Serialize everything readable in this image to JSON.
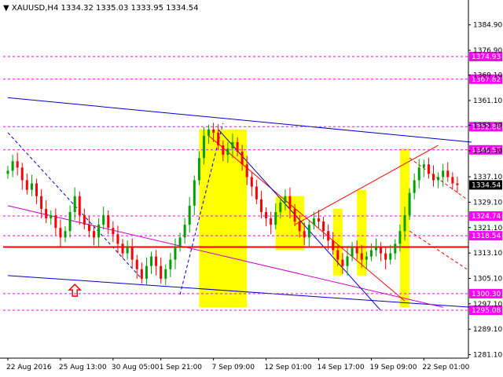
{
  "header": {
    "symbol": "XAUUSD,H4",
    "ohlc": "1334.32 1335.03 1333.95 1334.54"
  },
  "colors": {
    "background": "#ffffff",
    "candle_up": "#00a000",
    "candle_down": "#ff0000",
    "level_line": "#ff00ff",
    "support_line": "#ff0000",
    "channel_line": "#0000cc",
    "trend_line": "#cc00cc",
    "highlight_zone": "#ffff00",
    "current_badge": "#000000"
  },
  "chart_data": {
    "type": "candlestick",
    "symbol": "XAUUSD",
    "timeframe": "H4",
    "ylim": [
      1280,
      1392
    ],
    "y_ticks": [
      "1384.90",
      "1376.90",
      "1369.10",
      "1361.10",
      "1353.30",
      "1345.30",
      "1337.10",
      "1329.10",
      "1321.10",
      "1313.10",
      "1305.10",
      "1297.10",
      "1289.10",
      "1281.10"
    ],
    "x_ticks": [
      "22 Aug 2016",
      "25 Aug 13:00",
      "30 Aug 05:00",
      "1 Sep 21:00",
      "7 Sep 09:00",
      "12 Sep 01:00",
      "14 Sep 17:00",
      "19 Sep 09:00",
      "22 Sep 01:00"
    ],
    "levels": [
      "1374.93",
      "1367.82",
      "1352.86",
      "1345.57",
      "1324.74",
      "1318.54",
      "1300.30",
      "1295.08"
    ],
    "support_level": 1315.0,
    "current_price": "1334.54",
    "closes": [
      1339,
      1342,
      1340,
      1336,
      1333,
      1335,
      1331,
      1327,
      1324,
      1325,
      1321,
      1318,
      1320,
      1326,
      1331,
      1325,
      1322,
      1320,
      1318,
      1322,
      1325,
      1321,
      1319,
      1316,
      1313,
      1315,
      1311,
      1308,
      1305,
      1309,
      1312,
      1309,
      1305,
      1308,
      1311,
      1315,
      1318,
      1322,
      1328,
      1336,
      1343,
      1350,
      1352,
      1351,
      1347,
      1344,
      1346,
      1348,
      1345,
      1341,
      1337,
      1334,
      1330,
      1326,
      1324,
      1322,
      1326,
      1329,
      1331,
      1327,
      1323,
      1320,
      1318,
      1322,
      1324,
      1323,
      1320,
      1317,
      1314,
      1311,
      1309,
      1312,
      1315,
      1313,
      1311,
      1312,
      1314,
      1315,
      1313,
      1311,
      1313,
      1316,
      1320,
      1325,
      1332,
      1336,
      1340,
      1341,
      1338,
      1336,
      1337,
      1339,
      1337,
      1335,
      1334.5
    ],
    "arrow_marker": {
      "index": 14,
      "price": 1301,
      "direction": "up"
    }
  }
}
